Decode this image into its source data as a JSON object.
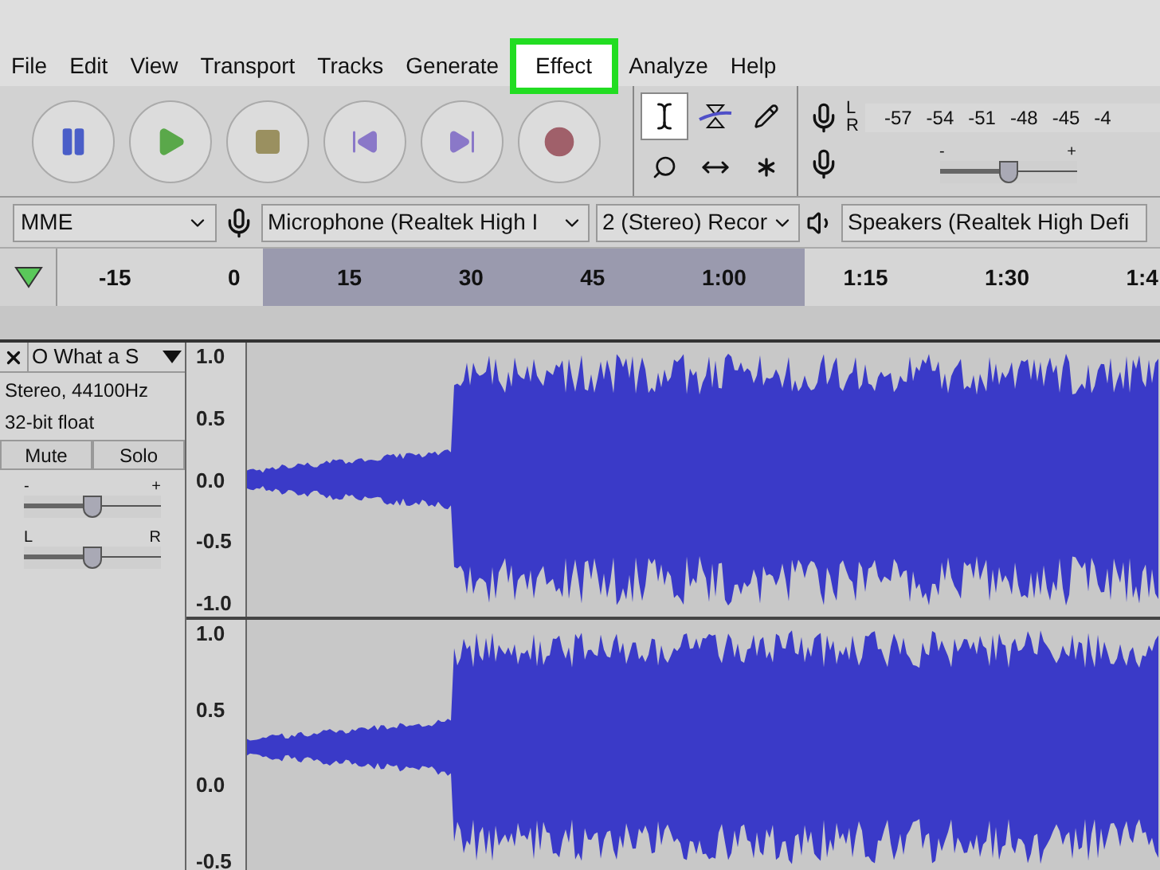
{
  "menu": [
    {
      "label": "File",
      "selected": false
    },
    {
      "label": "Edit",
      "selected": false
    },
    {
      "label": "View",
      "selected": false
    },
    {
      "label": "Transport",
      "selected": false
    },
    {
      "label": "Tracks",
      "selected": false
    },
    {
      "label": "Generate",
      "selected": false
    },
    {
      "label": "Effect",
      "selected": true
    },
    {
      "label": "Analyze",
      "selected": false
    },
    {
      "label": "Help",
      "selected": false
    }
  ],
  "meter": {
    "left": "L",
    "right": "R",
    "ticks": [
      "-57",
      "-54",
      "-51",
      "-48",
      "-45",
      "-4"
    ]
  },
  "playback_slider": {
    "min": "-",
    "max": "+",
    "level": 0.5
  },
  "devices": {
    "host": "MME",
    "microphone": "Microphone (Realtek High I",
    "channels": "2 (Stereo) Recor",
    "speakers": "Speakers (Realtek High Defi"
  },
  "ruler": {
    "ticks": [
      "-15",
      "0",
      "15",
      "30",
      "45",
      "1:00",
      "1:15",
      "1:30",
      "1:4"
    ]
  },
  "track": {
    "name": "O What a S",
    "info": [
      "Stereo, 44100Hz",
      "32-bit float"
    ],
    "mute": "Mute",
    "solo": "Solo",
    "gain": {
      "min": "-",
      "max": "+",
      "level": 0.5
    },
    "pan": {
      "min": "L",
      "max": "R",
      "level": 0.5
    }
  },
  "channels": [
    {
      "scale": [
        "1.0",
        "0.5",
        "0.0",
        "-0.5",
        "-1.0"
      ]
    },
    {
      "scale": [
        "1.0",
        "0.5",
        "0.0",
        "-0.5"
      ]
    }
  ]
}
